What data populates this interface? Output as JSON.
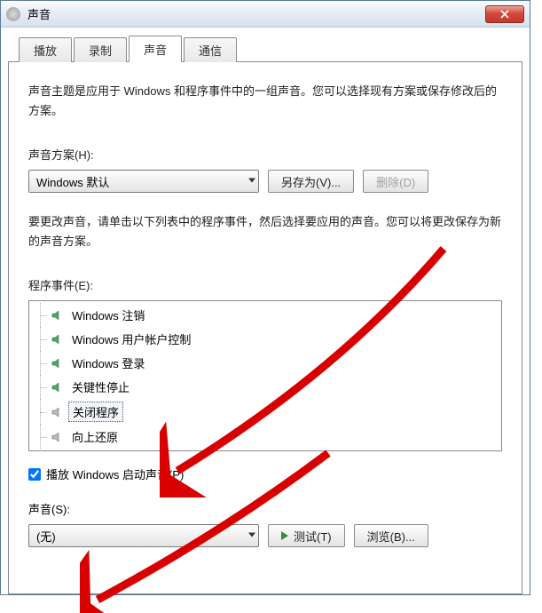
{
  "title": "声音",
  "tabs": [
    {
      "label": "播放"
    },
    {
      "label": "录制"
    },
    {
      "label": "声音",
      "active": true
    },
    {
      "label": "通信"
    }
  ],
  "description": "声音主题是应用于 Windows 和程序事件中的一组声音。您可以选择现有方案或保存修改后的方案。",
  "scheme": {
    "label": "声音方案(H):",
    "value": "Windows 默认",
    "save_as": "另存为(V)...",
    "delete": "删除(D)"
  },
  "events": {
    "help": "要更改声音，请单击以下列表中的程序事件，然后选择要应用的声音。您可以将更改保存为新的声音方案。",
    "label": "程序事件(E):",
    "items": [
      {
        "name": "Windows 注销",
        "has_sound": true
      },
      {
        "name": "Windows 用户帐户控制",
        "has_sound": true
      },
      {
        "name": "Windows 登录",
        "has_sound": true
      },
      {
        "name": "关键性停止",
        "has_sound": true
      },
      {
        "name": "关闭程序",
        "has_sound": false,
        "selected": true
      },
      {
        "name": "向上还原",
        "has_sound": false
      }
    ]
  },
  "play_startup": {
    "label": "播放 Windows 启动声音(P)",
    "checked": true
  },
  "sound": {
    "label": "声音(S):",
    "value": "(无)",
    "test": "测试(T)",
    "browse": "浏览(B)..."
  }
}
